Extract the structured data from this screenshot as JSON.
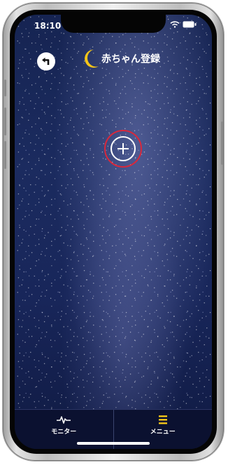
{
  "status_bar": {
    "time": "18:10"
  },
  "header": {
    "title": "赤ちゃん登録",
    "back_icon": "back-arrow-icon",
    "moon_icon": "crescent-moon-icon"
  },
  "main": {
    "add_icon": "plus-circle-icon"
  },
  "tabbar": {
    "tabs": [
      {
        "label": "モニター",
        "icon": "heartbeat-icon"
      },
      {
        "label": "メニュー",
        "icon": "menu-icon"
      }
    ]
  },
  "colors": {
    "background": "#1b2b5f",
    "tabbar": "#0b1130",
    "accent_ring": "#d8283c",
    "menu_icon": "#f0c419",
    "moon": "#f5c518"
  }
}
